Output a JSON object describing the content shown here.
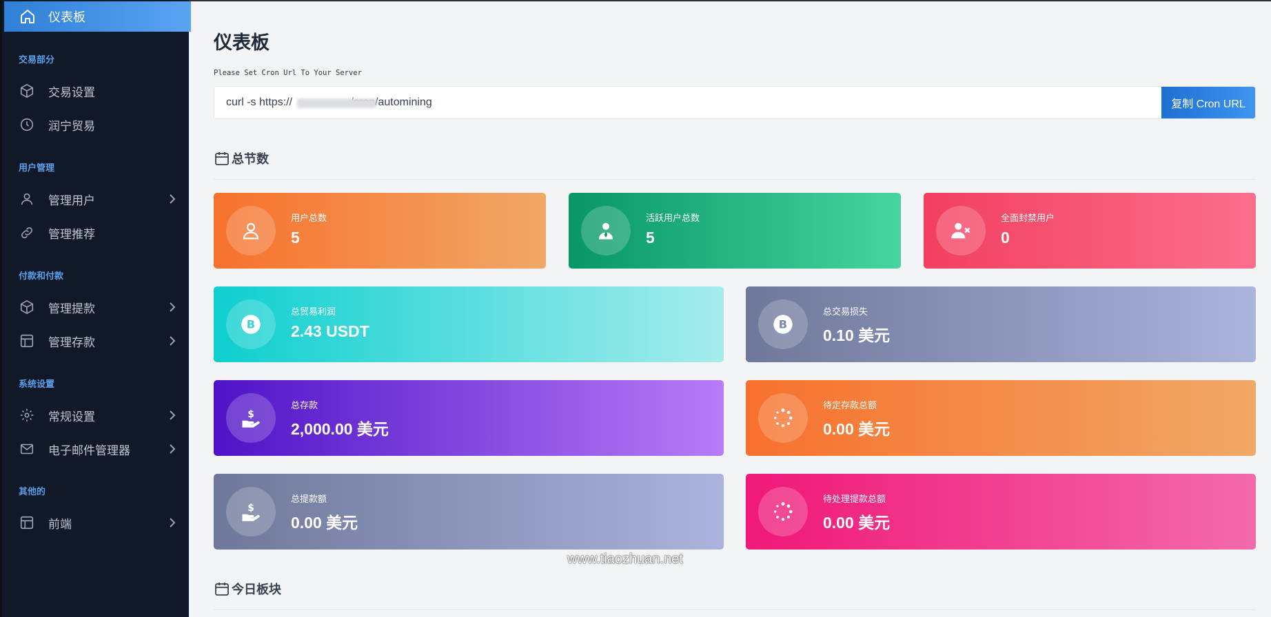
{
  "sidebar": {
    "active": {
      "label": "仪表板",
      "icon": "home-icon"
    },
    "sections": [
      {
        "title": "交易部分"
      },
      {
        "title": "用户管理"
      },
      {
        "title": "付款和付款"
      },
      {
        "title": "系统设置"
      },
      {
        "title": "其他的"
      }
    ],
    "items": [
      {
        "label": "交易设置",
        "icon": "cube-icon"
      },
      {
        "label": "润宁贸易",
        "icon": "clock-icon"
      },
      {
        "label": "管理用户",
        "icon": "user-icon"
      },
      {
        "label": "管理推荐",
        "icon": "link-icon"
      },
      {
        "label": "管理提款",
        "icon": "cube-icon"
      },
      {
        "label": "管理存款",
        "icon": "table-icon"
      },
      {
        "label": "常规设置",
        "icon": "gear-icon"
      },
      {
        "label": "电子邮件管理器",
        "icon": "mail-icon"
      },
      {
        "label": "前端",
        "icon": "layout-icon"
      }
    ]
  },
  "main": {
    "title": "仪表板",
    "cron_label": "Please Set Cron Url To Your Server",
    "cron_value": "curl -s https://                   /cron/automining",
    "copy_button": "复制 Cron URL",
    "section_totals": "总节数",
    "section_today": "今日板块",
    "cards": [
      {
        "label": "用户总数",
        "value": "5",
        "icon": "user-outline-icon",
        "color": "#f7712d"
      },
      {
        "label": "活跃用户总数",
        "value": "5",
        "icon": "user-tie-icon",
        "color": "#079767"
      },
      {
        "label": "全面封禁用户",
        "value": "0",
        "icon": "user-x-icon",
        "color": "#f33f5f"
      },
      {
        "label": "总贸易利润",
        "value": "2.43 USDT",
        "icon": "bitcoin-icon",
        "color": "#0ecfcf"
      },
      {
        "label": "总交易损失",
        "value": "0.10 美元",
        "icon": "bitcoin-icon",
        "color": "#6e789a"
      },
      {
        "label": "总存款",
        "value": "2,000.00 美元",
        "icon": "hand-dollar-icon",
        "color": "#4f13c7"
      },
      {
        "label": "待定存款总额",
        "value": "0.00 美元",
        "icon": "spinner-icon",
        "color": "#f7712d"
      },
      {
        "label": "总提款额",
        "value": "0.00 美元",
        "icon": "hand-dollar-icon",
        "color": "#6e789a"
      },
      {
        "label": "待处理提款总额",
        "value": "0.00 美元",
        "icon": "spinner-icon",
        "color": "#ef1878"
      }
    ]
  },
  "watermark": "www.tiaozhuan.net"
}
